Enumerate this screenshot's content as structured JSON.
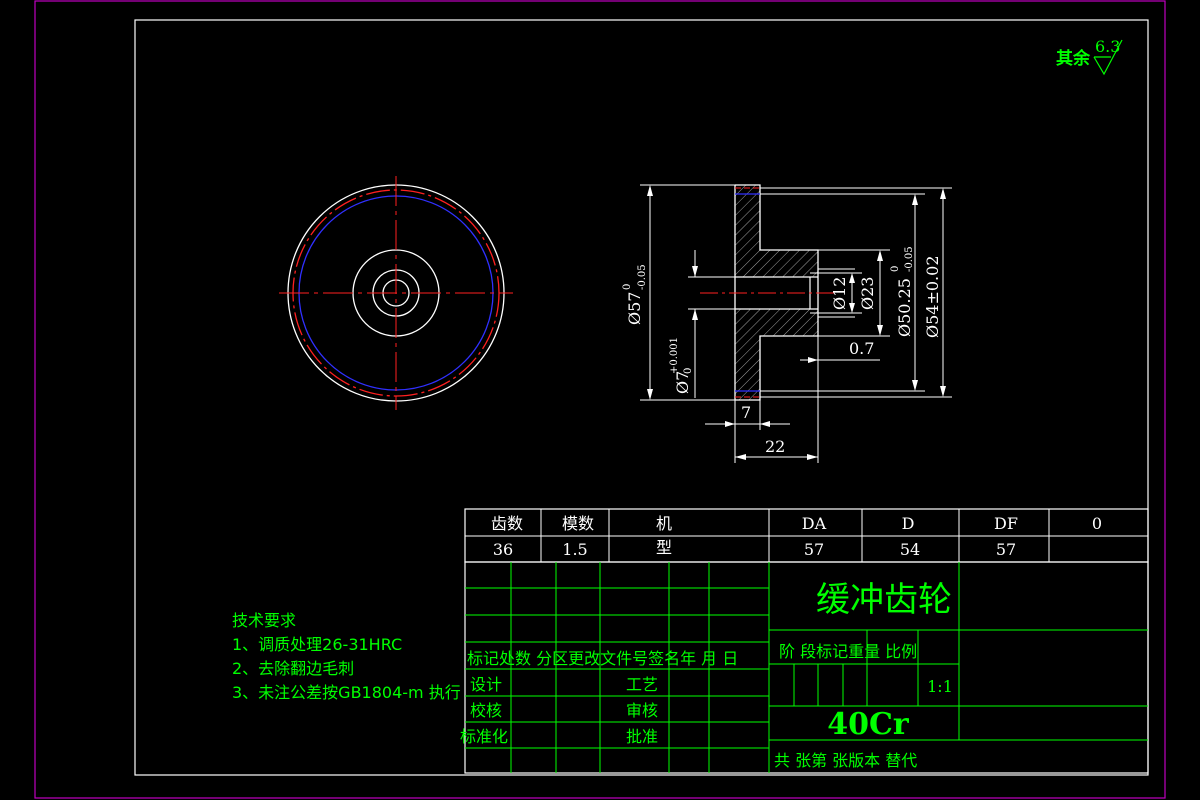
{
  "roughness": {
    "label": "其余",
    "value": "6.3"
  },
  "dimensions": {
    "d57": "Ø57",
    "d57_tol_upper": "0",
    "d57_tol_lower": "-0.05",
    "d7": "Ø7",
    "d7_tol_upper": "+0.001",
    "d7_tol_lower": "0",
    "d12": "Ø12",
    "d23": "Ø23",
    "d50": "Ø50.25",
    "d50_tol_upper": "0",
    "d50_tol_lower": "-0.05",
    "d54": "Ø54±0.02",
    "chamfer": "0.7",
    "len7": "7",
    "len22": "22"
  },
  "gear_table": {
    "headers": [
      "齿数",
      "模数",
      "机",
      "DA",
      "D",
      "DF",
      "0"
    ],
    "values": [
      "36",
      "1.5",
      "型",
      "57",
      "54",
      "57",
      ""
    ]
  },
  "tech_requirements": {
    "title": "技术要求",
    "items": [
      "1、调质处理26-31HRC",
      "2、去除翻边毛刺",
      "3、未注公差按GB1804-m 执行"
    ]
  },
  "title_block": {
    "part_name": "缓冲齿轮",
    "material": "40Cr",
    "scale": "1:1",
    "revision_header": "标记处数  分区更改文件号签名年 月 日",
    "stage_header": "阶 段标记重量 比例",
    "design": "设计",
    "process": "工艺",
    "check": "校核",
    "review": "审核",
    "standardize": "标准化",
    "approve": "批准",
    "footer": "共  张第  张版本    替代"
  }
}
